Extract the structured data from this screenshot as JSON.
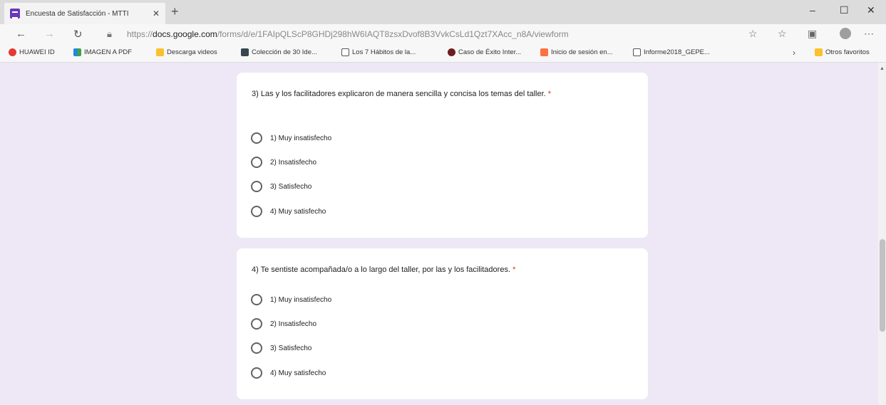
{
  "browser": {
    "tab_title": "Encuesta de Satisfacción - MTTI",
    "tab_close": "✕",
    "new_tab": "+",
    "url_prefix": "https://",
    "url_domain": "docs.google.com",
    "url_path": "/forms/d/e/1FAIpQLScP8GHDj298hW6IAQT8zsxDvof8B3VvkCsLd1Qzt7XAcc_n8A/viewform",
    "window_controls": [
      "–",
      "☐",
      "✕"
    ]
  },
  "bookmarks": [
    {
      "label": "HUAWEI ID",
      "color": "#e53935"
    },
    {
      "label": "IMAGEN A PDF",
      "color": "#1e88e5"
    },
    {
      "label": "Descarga videos",
      "color": "#fbc02d"
    },
    {
      "label": "Colección de 30 Ide...",
      "color": "#37474f"
    },
    {
      "label": "Los 7 Hábitos de la...",
      "color": "#ffffff"
    },
    {
      "label": "Caso de Éxito Inter...",
      "color": "#6d1b1b"
    },
    {
      "label": "Inicio de sesión en...",
      "color": "#ff7043"
    },
    {
      "label": "Informe2018_GEPE...",
      "color": "#ffffff"
    }
  ],
  "bookmarks_more": "Otros favoritos",
  "questions": [
    {
      "text": "3) Las y los facilitadores explicaron de manera sencilla y concisa los temas del taller.",
      "required": "*",
      "options": [
        "1) Muy insatisfecho",
        "2) Insatisfecho",
        "3) Satisfecho",
        "4) Muy satisfecho"
      ]
    },
    {
      "text": "4) Te sentiste acompañada/o a lo largo del taller, por las y los facilitadores.",
      "required": "*",
      "options": [
        "1) Muy insatisfecho",
        "2) Insatisfecho",
        "3) Satisfecho",
        "4) Muy satisfecho"
      ]
    }
  ],
  "colors": {
    "page_bg": "#ede7f6",
    "form_accent": "#673ab7",
    "required": "#d93025"
  }
}
